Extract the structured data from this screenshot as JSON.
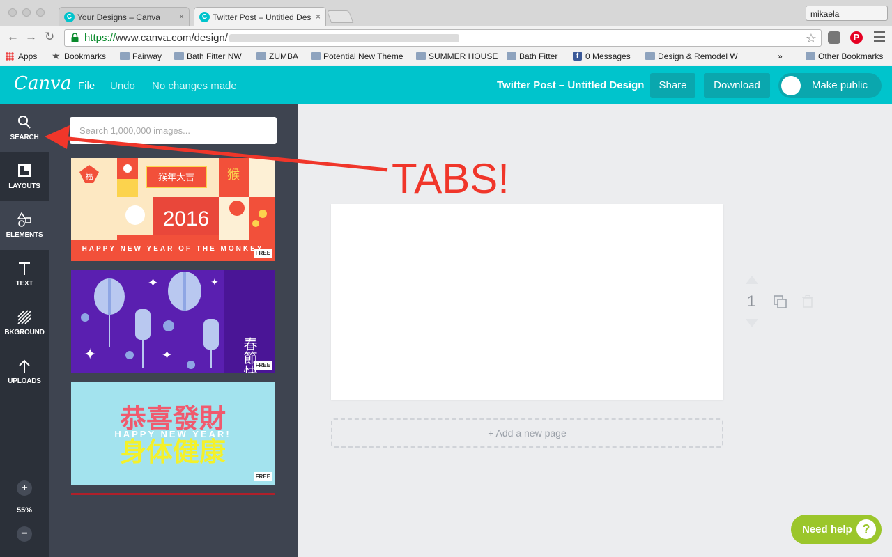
{
  "browser": {
    "tabs": [
      {
        "label": "Your Designs – Canva",
        "close": "×"
      },
      {
        "label": "Twitter Post – Untitled Des",
        "close": "×"
      }
    ],
    "user": "mikaela",
    "url_scheme": "https://",
    "url_host": "www.canva.com/design/",
    "bookmarks": [
      {
        "label": "Apps"
      },
      {
        "label": "Bookmarks"
      },
      {
        "label": "Fairway"
      },
      {
        "label": "Bath Fitter NW"
      },
      {
        "label": "ZUMBA"
      },
      {
        "label": "Potential New Theme"
      },
      {
        "label": "SUMMER HOUSE"
      },
      {
        "label": "Bath Fitter"
      },
      {
        "label": "0 Messages"
      },
      {
        "label": "Design & Remodel W"
      },
      {
        "label": "»"
      },
      {
        "label": "Other Bookmarks"
      }
    ]
  },
  "header": {
    "logo": "Canva",
    "file": "File",
    "undo": "Undo",
    "status": "No changes made",
    "title": "Twitter Post – Untitled Design",
    "share": "Share",
    "download": "Download",
    "make_public": "Make public"
  },
  "sidebar": {
    "items": [
      {
        "label": "SEARCH",
        "icon": "search-icon"
      },
      {
        "label": "LAYOUTS",
        "icon": "layouts-icon"
      },
      {
        "label": "ELEMENTS",
        "icon": "elements-icon"
      },
      {
        "label": "TEXT",
        "icon": "text-icon"
      },
      {
        "label": "BKGROUND",
        "icon": "background-icon"
      },
      {
        "label": "UPLOADS",
        "icon": "upload-icon"
      }
    ],
    "zoom_in": "+",
    "zoom_out": "−",
    "zoom": "55%"
  },
  "panel": {
    "search_placeholder": "Search 1,000,000 images...",
    "thumbnails": [
      {
        "badge": "FREE",
        "caption": "HAPPY NEW YEAR OF THE MONKEY",
        "year": "2016",
        "banner": "猴年大吉",
        "glyph1": "福",
        "glyph2": "猴"
      },
      {
        "badge": "FREE",
        "vertical": "春節快樂"
      },
      {
        "badge": "FREE",
        "line1": "恭喜發財",
        "line2": "HAPPY NEW YEAR!",
        "line3": "身体健康"
      }
    ]
  },
  "canvas": {
    "add_page": "+ Add a new page",
    "page_number": "1"
  },
  "annotation": {
    "text": "TABS!",
    "color": "#f0362a"
  },
  "help": {
    "label": "Need help",
    "icon": "?"
  },
  "colors": {
    "brand": "#00c4cc",
    "sidebar": "#2b3039",
    "panel": "#3e4450",
    "help": "#9bc62b"
  }
}
